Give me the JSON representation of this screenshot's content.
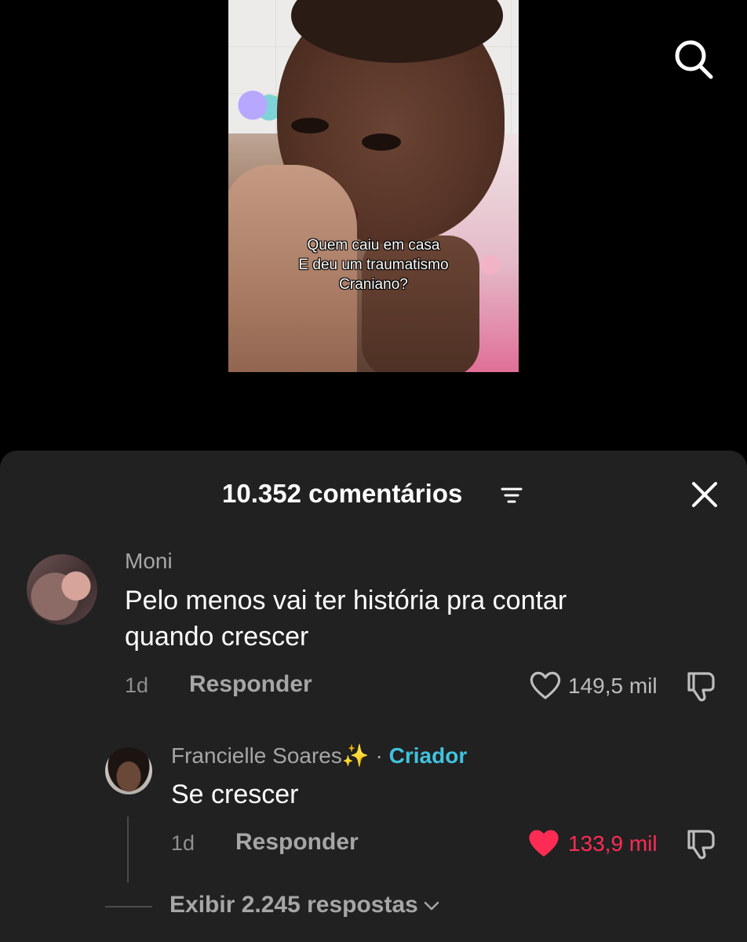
{
  "video": {
    "caption_lines": [
      "Quem caiu em casa",
      "E deu um traumatismo",
      "Craniano?"
    ]
  },
  "top_bar": {
    "search_icon": "search-icon"
  },
  "comments_panel": {
    "title": "10.352 comentários",
    "filter_icon": "filter-icon",
    "close_icon": "close-icon"
  },
  "comments": [
    {
      "username": "Moni",
      "text_lines": [
        "Pelo menos vai ter história pra contar",
        "quando crescer"
      ],
      "age": "1d",
      "reply_label": "Responder",
      "likes": "149,5 mil",
      "liked": false
    }
  ],
  "replies": [
    {
      "username": "Francielle Soares✨",
      "separator": "·",
      "badge": "Criador",
      "text": "Se crescer",
      "age": "1d",
      "reply_label": "Responder",
      "likes": "133,9 mil",
      "liked": true
    }
  ],
  "view_more": {
    "label": "Exibir 2.245 respostas"
  },
  "colors": {
    "sheet_bg": "#212121",
    "liked_red": "#fe2c55",
    "creator_blue": "#41c2de"
  }
}
